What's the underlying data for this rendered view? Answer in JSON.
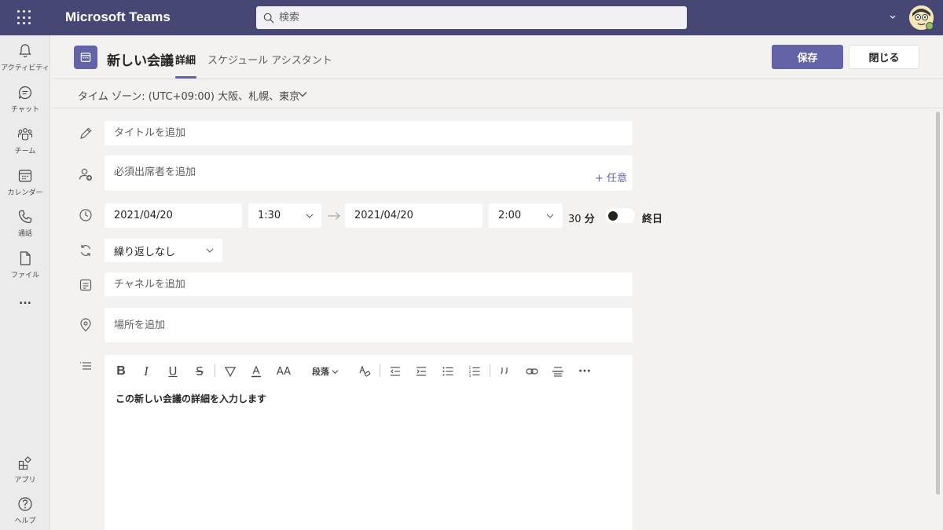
{
  "app": {
    "title": "Microsoft Teams"
  },
  "search": {
    "placeholder": "検索"
  },
  "rail": {
    "items": [
      {
        "label": "アクティビティ",
        "icon": "bell-icon"
      },
      {
        "label": "チャット",
        "icon": "chat-icon"
      },
      {
        "label": "チーム",
        "icon": "teams-icon"
      },
      {
        "label": "カレンダー",
        "icon": "calendar-icon"
      },
      {
        "label": "通話",
        "icon": "phone-icon"
      },
      {
        "label": "ファイル",
        "icon": "file-icon"
      }
    ],
    "more": "...",
    "bottom": [
      {
        "label": "アプリ",
        "icon": "apps-icon"
      },
      {
        "label": "ヘルプ",
        "icon": "help-icon"
      }
    ]
  },
  "header": {
    "title": "新しい会議",
    "tabs": [
      {
        "label": "詳細",
        "active": true
      },
      {
        "label": "スケジュール アシスタント",
        "active": false
      }
    ],
    "save_label": "保存",
    "close_label": "閉じる"
  },
  "timezone": {
    "label": "タイム ゾーン: (UTC+09:00) 大阪、札幌、東京"
  },
  "form": {
    "title_placeholder": "タイトルを追加",
    "attendees_placeholder": "必須出席者を追加",
    "optional_label": "+ 任意",
    "start_date": "2021/04/20",
    "start_time": "1:30",
    "end_date": "2021/04/20",
    "end_time": "2:00",
    "duration_value": "30",
    "duration_unit": "分",
    "all_day_label": "終日",
    "all_day": false,
    "recurrence": "繰り返しなし",
    "channel_placeholder": "チャネルを追加",
    "location_placeholder": "場所を追加"
  },
  "editor": {
    "paragraph_label": "段落",
    "more_label": "···",
    "placeholder": "この新しい会議の詳細を入力します"
  },
  "colors": {
    "brand": "#6264a7",
    "topbar": "#464775",
    "presence": "#92c353"
  }
}
